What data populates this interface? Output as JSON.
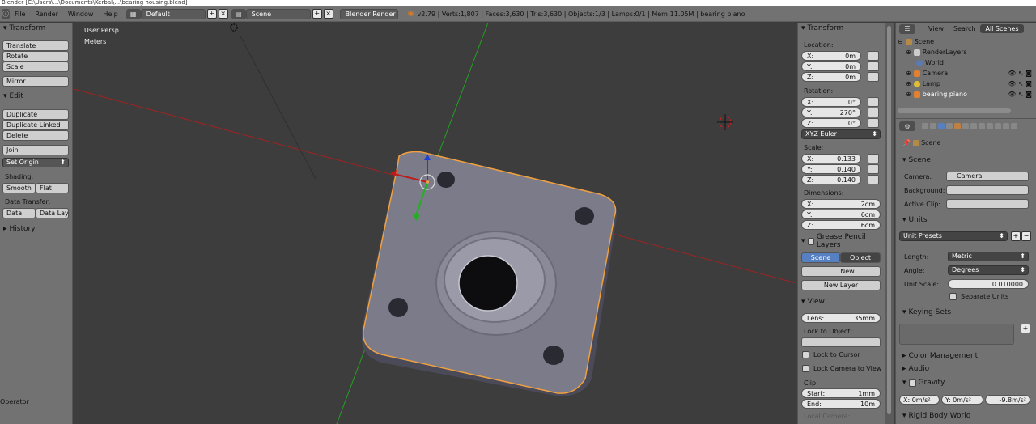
{
  "titlebar": {
    "text": "Blender  [C:\\Users\\...\\Documents\\Kerbal\\...\\bearing housing.blend]"
  },
  "menu": [
    "File",
    "Render",
    "Window",
    "Help"
  ],
  "screen_layout": "Default",
  "scene_name": "Scene",
  "render_engine": "Blender Render",
  "status": "v2.79 | Verts:1,807 | Faces:3,630 | Tris:3,630 | Objects:1/3 | Lamps:0/1 | Mem:11.05M | bearing piano",
  "toolshelf": {
    "transform_header": "Transform",
    "translate": "Translate",
    "rotate": "Rotate",
    "scale": "Scale",
    "mirror": "Mirror",
    "edit_header": "Edit",
    "duplicate": "Duplicate",
    "duplicate_linked": "Duplicate Linked",
    "delete": "Delete",
    "join": "Join",
    "set_origin": "Set Origin",
    "shading_label": "Shading:",
    "smooth": "Smooth",
    "flat": "Flat",
    "data_transfer_label": "Data Transfer:",
    "data": "Data",
    "data_layout": "Data Layo",
    "history_header": "History",
    "operator_header": "Operator"
  },
  "viewport": {
    "view_name": "User Persp",
    "units": "Meters"
  },
  "npanel": {
    "transform_header": "Transform",
    "location_label": "Location:",
    "location": {
      "x": "0m",
      "y": "0m",
      "z": "0m"
    },
    "rotation_label": "Rotation:",
    "rotation": {
      "x": "0°",
      "y": "270°",
      "z": "0°"
    },
    "rotation_mode": "XYZ Euler",
    "scale_label": "Scale:",
    "scale": {
      "x": "0.133",
      "y": "0.140",
      "z": "0.140"
    },
    "dimensions_label": "Dimensions:",
    "dimensions": {
      "x": "2cm",
      "y": "6cm",
      "z": "6cm"
    },
    "gp_header": "Grease Pencil Layers",
    "gp_scene": "Scene",
    "gp_object": "Object",
    "gp_new": "New",
    "gp_new_layer": "New Layer",
    "view_header": "View",
    "lens_label": "Lens:",
    "lens_value": "35mm",
    "lock_to_object_label": "Lock to Object:",
    "lock_to_cursor": "Lock to Cursor",
    "lock_camera_to_view": "Lock Camera to View",
    "clip_label": "Clip:",
    "clip_start_label": "Start:",
    "clip_start": "1mm",
    "clip_end_label": "End:",
    "clip_end": "10m",
    "local_camera_label": "Local Camera:",
    "axis_x": "X:",
    "axis_y": "Y:",
    "axis_z": "Z:"
  },
  "outliner": {
    "view": "View",
    "search": "Search",
    "all_scenes": "All Scenes",
    "items": [
      "Scene",
      "RenderLayers",
      "World",
      "Camera",
      "Lamp",
      "bearing piano"
    ]
  },
  "properties": {
    "breadcrumb": "Scene",
    "scene_header": "Scene",
    "camera_label": "Camera:",
    "camera_value": "Camera",
    "background_label": "Background:",
    "active_clip_label": "Active Clip:",
    "units_header": "Units",
    "unit_presets": "Unit Presets",
    "length_label": "Length:",
    "length_value": "Metric",
    "angle_label": "Angle:",
    "angle_value": "Degrees",
    "unit_scale_label": "Unit Scale:",
    "unit_scale_value": "0.010000",
    "separate_units": "Separate Units",
    "keying_sets_header": "Keying Sets",
    "color_management": "Color Management",
    "audio": "Audio",
    "gravity": "Gravity",
    "gravity_x": "X: 0m/s²",
    "gravity_y": "Y: 0m/s²",
    "gravity_z": "-9.8m/s²",
    "rigid_body_world": "Rigid Body World"
  },
  "colors": {
    "selection_outline": "#f0a040",
    "x_axis": "#c02020",
    "y_axis": "#20a020",
    "z_axis": "#2040d0",
    "tab_active": "#5680c2"
  }
}
